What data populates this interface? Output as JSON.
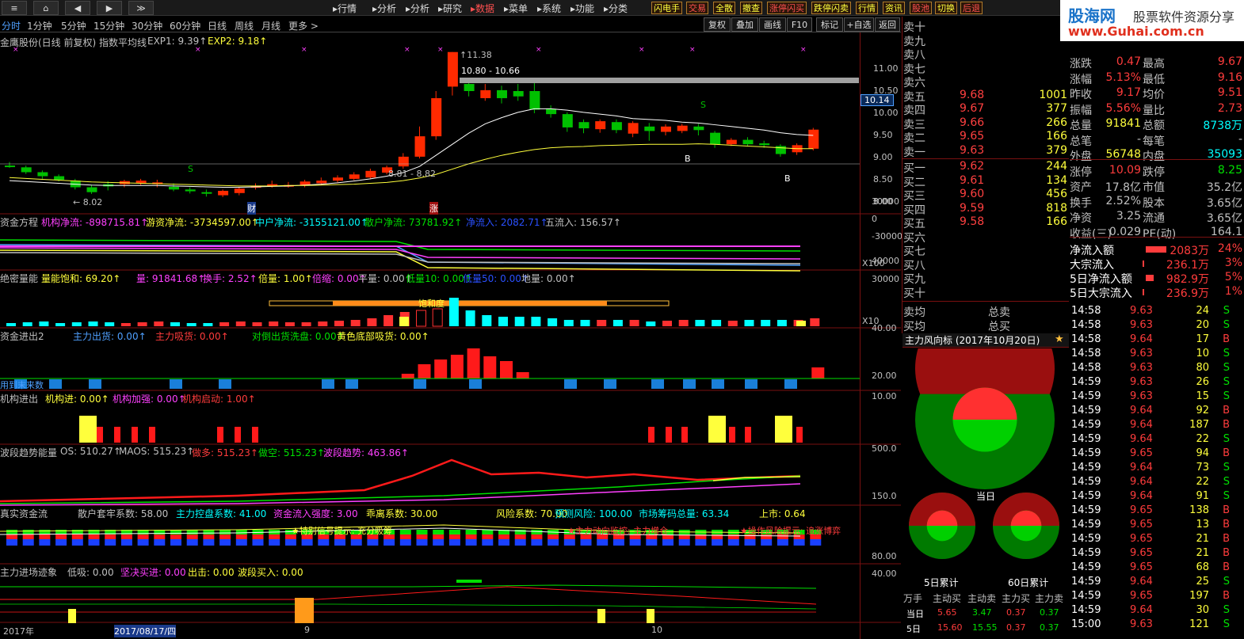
{
  "nav": {
    "home": "⌂",
    "back": "◀",
    "fwd": "▶",
    "more": "≫"
  },
  "top_menu": [
    "行情",
    "分析",
    "分析",
    "研究",
    "数据",
    "菜单",
    "系统",
    "功能",
    "分类"
  ],
  "top_badges": [
    "闪电手",
    "交易",
    "全散",
    "撤查",
    "涨停闪买",
    "跌停闪卖",
    "行情",
    "资讯",
    "股池",
    "切换",
    "后退"
  ],
  "logo": {
    "title": "股海网",
    "subtitle": "股票软件资源分享",
    "url": "www.Guhai.com.cn"
  },
  "periods": [
    "分时",
    "1分钟",
    "5分钟",
    "15分钟",
    "30分钟",
    "60分钟",
    "日线",
    "周线",
    "月线",
    "更多 >"
  ],
  "tools": [
    "复权",
    "叠加",
    "画线",
    "F10",
    "标记",
    "+自选",
    "返回"
  ],
  "chart_data": [
    {
      "type": "candlestick",
      "title": "金鹰股份(日线 前复权) 指数平均线",
      "indicators": [
        {
          "name": "EXP1",
          "value": "9.39"
        },
        {
          "name": "EXP2",
          "value": "9.18"
        }
      ],
      "y_ticks": [
        "11.50",
        "11.00",
        "10.50",
        "10.00",
        "9.50",
        "9.00",
        "8.50",
        "8.00"
      ],
      "last_price": "10.14",
      "high_label": "11.38",
      "low_label": "8.02",
      "band_label": "10.80 - 10.66",
      "cross_label": "8.81 - 8.82",
      "markers": {
        "buy": "B",
        "sell": "S",
        "cai": "财",
        "zhang": "涨"
      }
    },
    {
      "type": "line",
      "title": "资金方程",
      "indicators": [
        "机构净流: -898715.81",
        "游资净流: -3734597.00",
        "中户净流: -3155121.00",
        "散户净流: 73781.92",
        "净流入: 2082.71",
        "五流入: 156.57"
      ],
      "y_ticks": [
        "30000",
        "0",
        "-30000"
      ],
      "scale": "X100"
    },
    {
      "type": "bar",
      "title": "绝密量能",
      "indicators": [
        "量能饱和: 69.20",
        "量: 91841.68",
        "换手: 2.52",
        "倍量: 1.00",
        "倍缩: 0.00",
        "平量: 0.00",
        "低量10: 0.00",
        "低量50: 0.00",
        "地量: 0.00"
      ],
      "y_ticks": [
        "40000",
        "30000"
      ],
      "scale": "X10",
      "overlay": "饱和度"
    },
    {
      "type": "bar",
      "title": "资金进出2",
      "indicators": [
        "主力出货: 0.00",
        "主力吸货: 0.00",
        "对倒出货洗盘: 0.00",
        "黄色底部吸货: 0.00"
      ],
      "y_ticks": [
        "40.00"
      ],
      "note": "用到末来数"
    },
    {
      "type": "bar",
      "title": "机构进出",
      "indicators": [
        "机构进: 0.00",
        "机构加强: 0.00",
        "机构启动: 1.00"
      ],
      "y_ticks": [
        "20.00",
        "10.00"
      ]
    },
    {
      "type": "line",
      "title": "波段趋势能量",
      "indicators": [
        "OS: 510.27",
        "MAOS: 515.23",
        "做多: 515.23",
        "做空: 515.23",
        "波段趋势: 463.86"
      ],
      "y_ticks": [
        "500.0"
      ]
    },
    {
      "type": "bar",
      "title": "真实资金流",
      "indicators": [
        "散户套牢系数: 58.00",
        "主力控盘系数: 41.00",
        "资金流入强度: 3.00",
        "乖离系数: 30.00",
        "风险系数: 70.00",
        "预测风险: 100.00",
        "市场筹码总量: 63.34",
        "上市: 0.64"
      ],
      "y_ticks": [
        "150.0"
      ],
      "notes": [
        "★特别信号提示: 充分吸筹",
        "★主力动向监控: 主力增仓",
        "★操作风险提示: 追涨博弈"
      ]
    },
    {
      "type": "line",
      "title": "主力进场迹象",
      "indicators": [
        "低吸: 0.00",
        "坚决买进: 0.00",
        "出击: 0.00",
        "波段买入: 0.00"
      ],
      "y_ticks": [
        "80.00",
        "40.00"
      ]
    }
  ],
  "x_axis": {
    "year": "2017年",
    "cursor": "2017/08/17/四",
    "m9": "9",
    "m10": "10"
  },
  "orderbook": {
    "asks": [
      {
        "l": "卖十"
      },
      {
        "l": "卖九"
      },
      {
        "l": "卖八"
      },
      {
        "l": "卖七"
      },
      {
        "l": "卖六"
      },
      {
        "l": "卖五",
        "p": "9.68",
        "v": "1001"
      },
      {
        "l": "卖四",
        "p": "9.67",
        "v": "377"
      },
      {
        "l": "卖三",
        "p": "9.66",
        "v": "266"
      },
      {
        "l": "卖二",
        "p": "9.65",
        "v": "166"
      },
      {
        "l": "卖一",
        "p": "9.63",
        "v": "379"
      }
    ],
    "bids": [
      {
        "l": "买一",
        "p": "9.62",
        "v": "244"
      },
      {
        "l": "买二",
        "p": "9.61",
        "v": "134"
      },
      {
        "l": "买三",
        "p": "9.60",
        "v": "456"
      },
      {
        "l": "买四",
        "p": "9.59",
        "v": "818"
      },
      {
        "l": "买五",
        "p": "9.58",
        "v": "166"
      },
      {
        "l": "买六"
      },
      {
        "l": "买七"
      },
      {
        "l": "买八"
      },
      {
        "l": "买九"
      },
      {
        "l": "买十"
      }
    ],
    "avg_sell": "卖均",
    "avg_buy": "买均",
    "tot_sell": "总卖",
    "tot_buy": "总买"
  },
  "stats": [
    {
      "a": "涨跌",
      "b": "0.47",
      "c": "最高",
      "d": "9.67"
    },
    {
      "a": "涨幅",
      "b": "5.13%",
      "c": "最低",
      "d": "9.16"
    },
    {
      "a": "昨收",
      "b": "9.17",
      "c": "均价",
      "d": "9.51"
    },
    {
      "a": "振幅",
      "b": "5.56%",
      "c": "量比",
      "d": "2.73"
    },
    {
      "a": "总量",
      "b": "91841",
      "c": "总额",
      "d": "8738万"
    },
    {
      "a": "总笔",
      "b": "-",
      "c": "每笔",
      "d": "-"
    },
    {
      "a": "外盘",
      "b": "56748",
      "c": "内盘",
      "d": "35093"
    },
    {
      "a": "涨停",
      "b": "10.09",
      "c": "跌停",
      "d": "8.25"
    },
    {
      "a": "资产",
      "b": "17.8亿",
      "c": "市值",
      "d": "35.2亿"
    },
    {
      "a": "换手",
      "b": "2.52%",
      "c": "股本",
      "d": "3.65亿"
    },
    {
      "a": "净资",
      "b": "3.25",
      "c": "流通",
      "d": "3.65亿"
    },
    {
      "a": "收益(三)",
      "b": "0.029",
      "c": "PE(动)",
      "d": "164.1"
    }
  ],
  "flows": [
    {
      "a": "净流入额",
      "v": "2083万",
      "p": "24%"
    },
    {
      "a": "大宗流入",
      "v": "236.1万",
      "p": "3%"
    },
    {
      "a": "5日净流入额",
      "v": "982.9万",
      "p": "5%"
    },
    {
      "a": "5日大宗流入",
      "v": "236.9万",
      "p": "1%"
    }
  ],
  "wind": {
    "title": "主力风向标 (2017年10月20日)",
    "today": "当日",
    "d5": "5日累计",
    "d60": "60日累计"
  },
  "wind_table": {
    "headers": [
      "万手",
      "主动买",
      "主动卖",
      "主力买",
      "主力卖"
    ],
    "rows": [
      [
        "当日",
        "5.65",
        "3.47",
        "0.37",
        "0.37"
      ],
      [
        "5日",
        "15.60",
        "15.55",
        "0.37",
        "0.37"
      ]
    ]
  },
  "ticks": [
    [
      "14:58",
      "9.63",
      "24",
      "S"
    ],
    [
      "14:58",
      "9.63",
      "20",
      "S"
    ],
    [
      "14:58",
      "9.64",
      "17",
      "B"
    ],
    [
      "14:58",
      "9.63",
      "10",
      "S"
    ],
    [
      "14:58",
      "9.63",
      "80",
      "S"
    ],
    [
      "14:59",
      "9.63",
      "26",
      "S"
    ],
    [
      "14:59",
      "9.63",
      "15",
      "S"
    ],
    [
      "14:59",
      "9.64",
      "92",
      "B"
    ],
    [
      "14:59",
      "9.64",
      "187",
      "B"
    ],
    [
      "14:59",
      "9.64",
      "22",
      "S"
    ],
    [
      "14:59",
      "9.65",
      "94",
      "B"
    ],
    [
      "14:59",
      "9.64",
      "73",
      "S"
    ],
    [
      "14:59",
      "9.64",
      "22",
      "S"
    ],
    [
      "14:59",
      "9.64",
      "91",
      "S"
    ],
    [
      "14:59",
      "9.65",
      "138",
      "B"
    ],
    [
      "14:59",
      "9.65",
      "13",
      "B"
    ],
    [
      "14:59",
      "9.65",
      "21",
      "B"
    ],
    [
      "14:59",
      "9.65",
      "21",
      "B"
    ],
    [
      "14:59",
      "9.65",
      "68",
      "B"
    ],
    [
      "14:59",
      "9.64",
      "25",
      "S"
    ],
    [
      "14:59",
      "9.65",
      "197",
      "B"
    ],
    [
      "14:59",
      "9.64",
      "30",
      "S"
    ],
    [
      "15:00",
      "9.63",
      "121",
      "S"
    ]
  ]
}
